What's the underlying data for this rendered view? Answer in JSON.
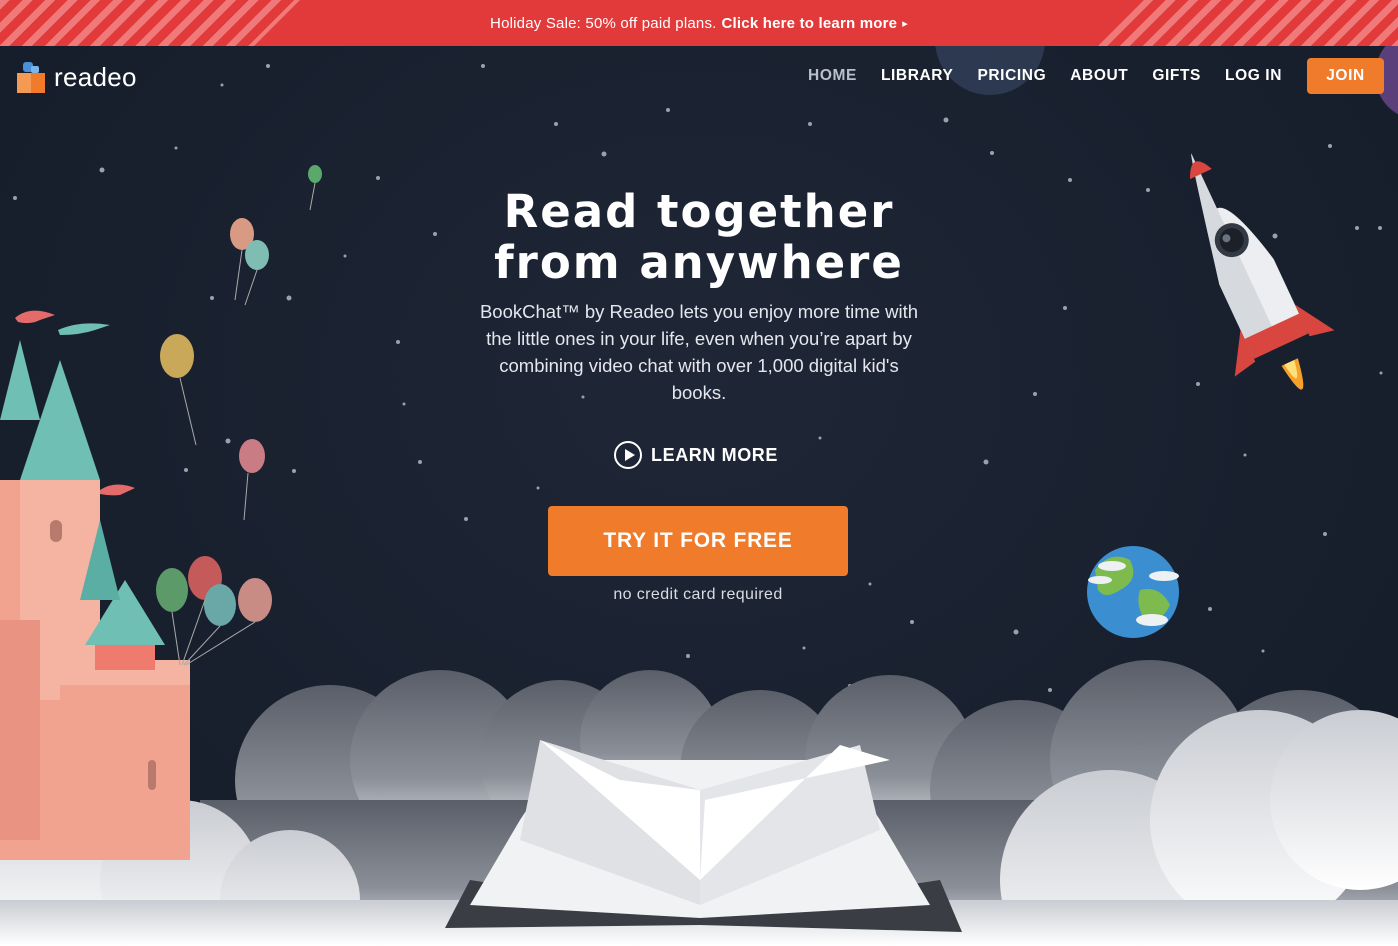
{
  "promo": {
    "text": "Holiday Sale: 50% off paid plans.",
    "link": "Click here to learn more",
    "caret": "▸"
  },
  "logo": {
    "text": "readeo",
    "icon": "gift-box-icon"
  },
  "nav": {
    "items": [
      {
        "label": "HOME",
        "active": true
      },
      {
        "label": "LIBRARY",
        "active": false
      },
      {
        "label": "PRICING",
        "active": false
      },
      {
        "label": "ABOUT",
        "active": false
      },
      {
        "label": "GIFTS",
        "active": false
      },
      {
        "label": "LOG IN",
        "active": false
      }
    ],
    "join": "JOIN"
  },
  "hero": {
    "title_line1": "Read together",
    "title_line2": "from anywhere",
    "subtitle": "BookChat™ by Readeo lets you enjoy more time with the little ones in your life, even when you’re apart by combining video chat with over 1,000 digital kid's books.",
    "learn_more": "LEARN MORE",
    "cta": "TRY IT FOR FREE",
    "cta_note": "no credit card required"
  },
  "colors": {
    "banner": "#e23a3a",
    "accent": "#ef7b2b",
    "night_sky": "#1b2130"
  }
}
